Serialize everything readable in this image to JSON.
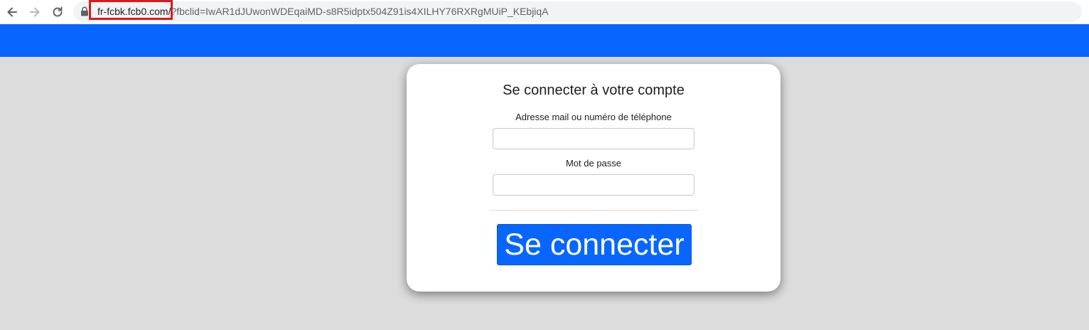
{
  "browser": {
    "url_host": "fr-fcbk.fcb0.com/",
    "url_path": "?fbclid=IwAR1dJUwonWDEqaiMD-s8R5idptx504Z91is4XILHY76RXRgMUiP_KEbjiqA",
    "highlight_color": "#d81b1b",
    "icons": [
      "back-arrow-icon",
      "forward-arrow-icon",
      "reload-icon",
      "lock-icon"
    ]
  },
  "header": {
    "color": "#0866ff"
  },
  "login": {
    "title": "Se connecter à votre compte",
    "email_label": "Adresse mail ou numéro de téléphone",
    "email_value": "",
    "password_label": "Mot de passe",
    "password_value": "",
    "submit_label": "Se connecter",
    "button_color": "#0866ff"
  }
}
